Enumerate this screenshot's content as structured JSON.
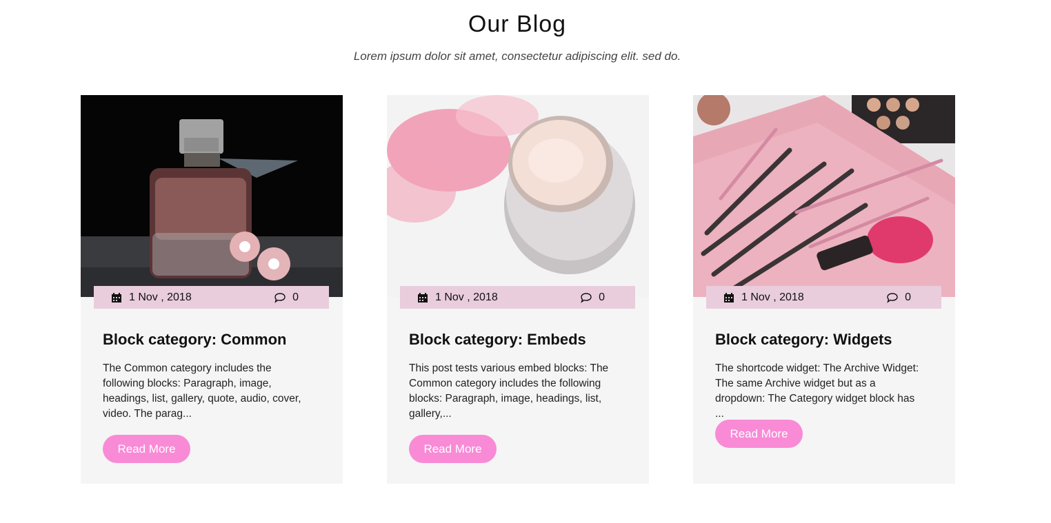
{
  "header": {
    "title": "Our Blog",
    "subtitle": "Lorem ipsum dolor sit amet, consectetur adipiscing elit. sed do."
  },
  "posts": [
    {
      "title": "Block category: Common",
      "date": "1 Nov , 2018",
      "comments": "0",
      "excerpt": "The Common category includes the following blocks: Paragraph, image, headings, list, gallery, quote, audio, cover, video. The parag...",
      "read_more": "Read More",
      "image": "perfume-bottle-with-pink-flowers"
    },
    {
      "title": "Block category: Embeds",
      "date": "1 Nov , 2018",
      "comments": "0",
      "excerpt": "This post tests various embed blocks: The Common category includes the following blocks: Paragraph, image, headings, list, gallery,...",
      "read_more": "Read More",
      "image": "cream-jar-with-pink-petals"
    },
    {
      "title": "Block category: Widgets",
      "date": "1 Nov , 2018",
      "comments": "0",
      "excerpt": "The shortcode widget: The Archive Widget: The same Archive widget but as a dropdown: The Category widget block has ...",
      "read_more": "Read More",
      "image": "makeup-brushes-in-pink-case"
    }
  ],
  "colors": {
    "meta_bar": "#e9cddd",
    "button": "#f98ad6",
    "card_bg": "#f5f5f5"
  },
  "icons": {
    "date": "calendar-icon",
    "comments": "comment-bubble-icon"
  }
}
